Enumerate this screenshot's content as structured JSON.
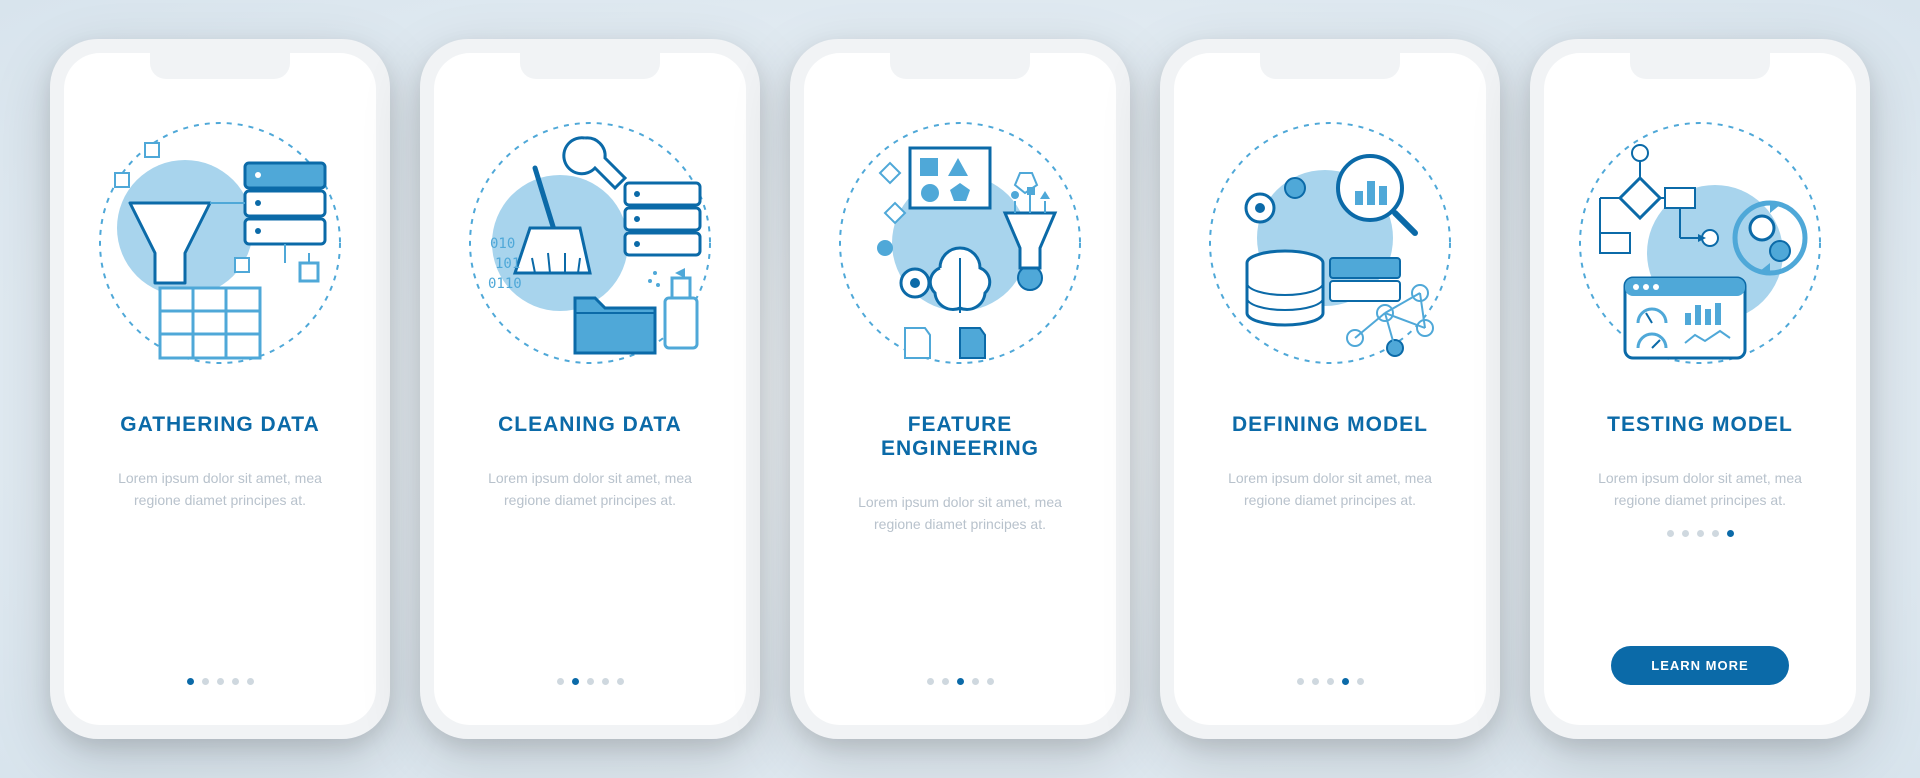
{
  "colors": {
    "primary": "#0b6aa8",
    "accent": "#4fa8d8",
    "light": "#a8d4ed",
    "muted": "#b8c2cc"
  },
  "screens": [
    {
      "title": "GATHERING DATA",
      "description": "Lorem ipsum dolor sit amet, mea regione diamet principes at.",
      "icon": "gathering-data",
      "active_dot": 0
    },
    {
      "title": "CLEANING DATA",
      "description": "Lorem ipsum dolor sit amet, mea regione diamet principes at.",
      "icon": "cleaning-data",
      "active_dot": 1
    },
    {
      "title": "FEATURE ENGINEERING",
      "description": "Lorem ipsum dolor sit amet, mea regione diamet principes at.",
      "icon": "feature-engineering",
      "active_dot": 2
    },
    {
      "title": "DEFINING MODEL",
      "description": "Lorem ipsum dolor sit amet, mea regione diamet principes at.",
      "icon": "defining-model",
      "active_dot": 3
    },
    {
      "title": "TESTING MODEL",
      "description": "Lorem ipsum dolor sit amet, mea regione diamet principes at.",
      "icon": "testing-model",
      "active_dot": 4,
      "cta_label": "LEARN MORE"
    }
  ],
  "dot_count": 5
}
